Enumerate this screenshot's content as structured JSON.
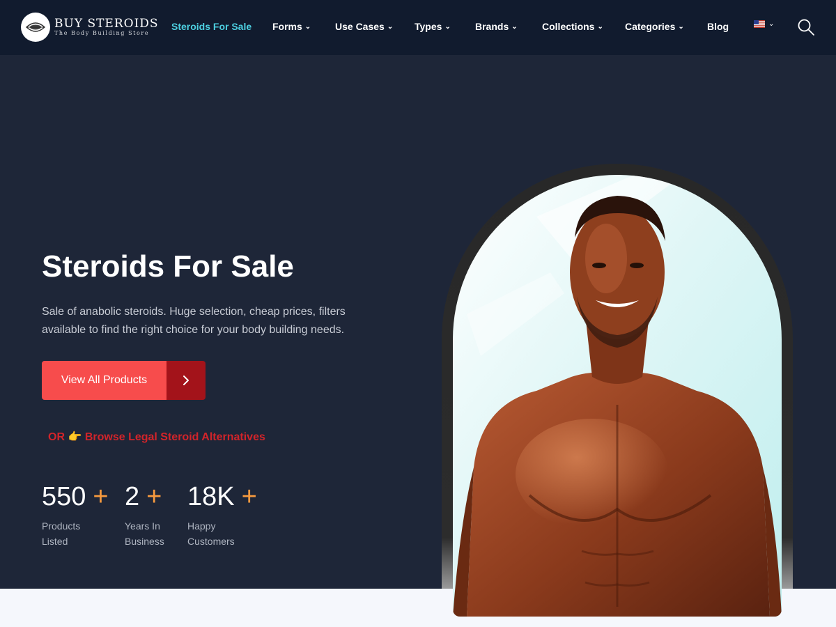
{
  "brand": {
    "title": "BUY STEROIDS",
    "tagline": "The Body Building Store"
  },
  "nav": {
    "items": [
      {
        "label": "Steroids For Sale",
        "active": true,
        "dropdown": false
      },
      {
        "label": "Forms",
        "dropdown": true
      },
      {
        "label": "Use Cases",
        "dropdown": true
      },
      {
        "label": "Types",
        "dropdown": true
      },
      {
        "label": "Brands",
        "dropdown": true
      },
      {
        "label": "Collections",
        "dropdown": true
      },
      {
        "label": "Categories",
        "dropdown": true
      },
      {
        "label": "Blog",
        "dropdown": false
      }
    ],
    "language_icon": "us-flag-icon",
    "search_icon": "search-icon"
  },
  "hero": {
    "title": "Steroids For Sale",
    "description": "Sale of anabolic steroids. Huge selection, cheap prices, filters available to find the right choice for your body building needs.",
    "cta_label": "View All Products",
    "alt_prefix": "OR 👉",
    "alt_link": "Browse Legal Steroid Alternatives",
    "stats": [
      {
        "value": "550",
        "plus": "+",
        "label": "Products Listed"
      },
      {
        "value": "2",
        "plus": "+",
        "label": "Years In Business"
      },
      {
        "value": "18K",
        "plus": "+",
        "label": "Happy Customers"
      }
    ]
  },
  "colors": {
    "nav_bg": "#111b2e",
    "hero_bg": "#1e2638",
    "accent_cyan": "#4dd0e1",
    "cta_red": "#f74c4c",
    "cta_dark": "#a3131a",
    "plus_orange": "#f79a3e",
    "link_red": "#d2242a"
  }
}
